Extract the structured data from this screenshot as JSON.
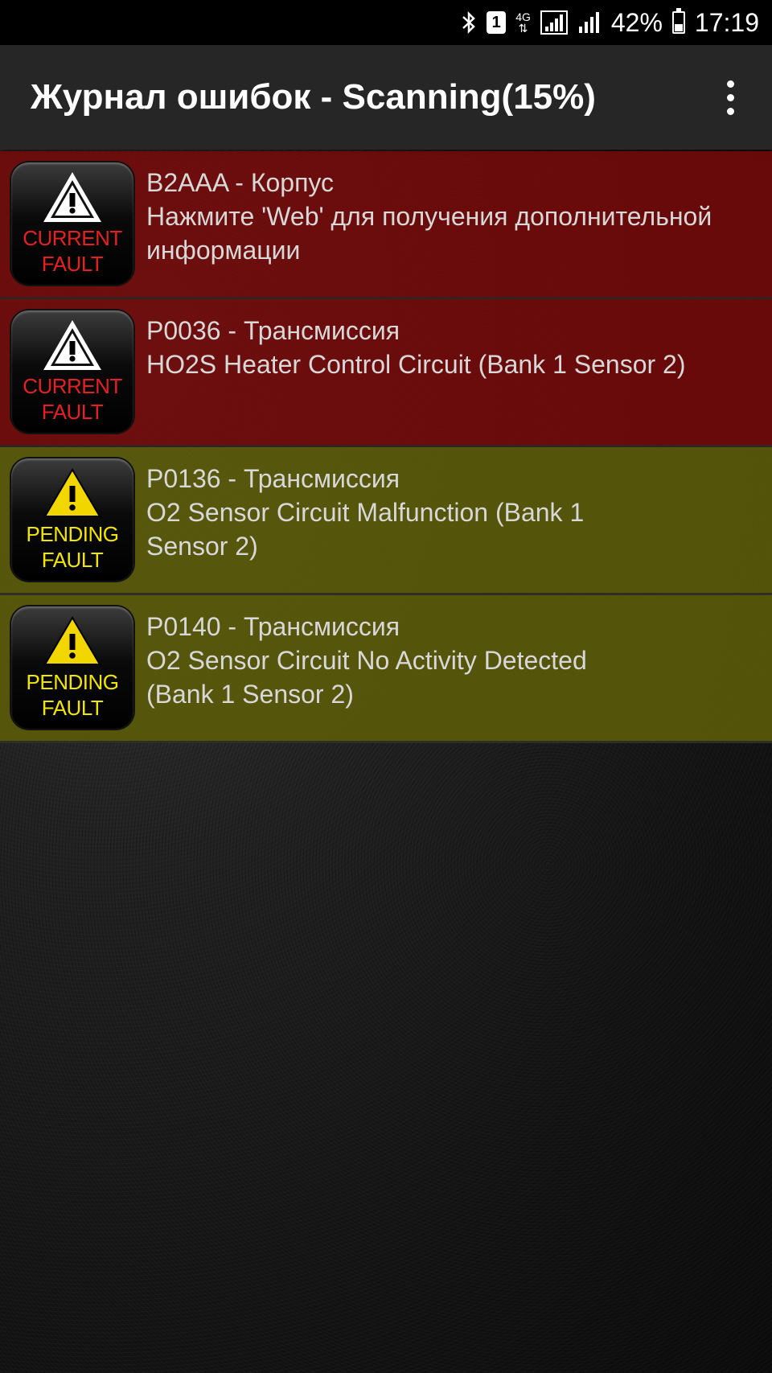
{
  "status_bar": {
    "bluetooth_icon": "bluetooth-icon",
    "sim_label": "1",
    "network_label": "4G",
    "battery_percent": "42%",
    "battery_level": 0.42,
    "time": "17:19"
  },
  "app_bar": {
    "title": "Журнал ошибок - Scanning(15%)",
    "menu_icon": "more-vertical-icon"
  },
  "faults": [
    {
      "kind": "current",
      "badge_line1": "CURRENT",
      "badge_line2": "FAULT",
      "code": "B2AAA - Корпус",
      "description": "Нажмите 'Web' для получения дополнительной информации"
    },
    {
      "kind": "current",
      "badge_line1": "CURRENT",
      "badge_line2": "FAULT",
      "code": "P0036 - Трансмиссия",
      "description": "HO2S Heater Control Circuit (Bank 1 Sensor 2)"
    },
    {
      "kind": "pending",
      "badge_line1": "PENDING",
      "badge_line2": "FAULT",
      "code": "P0136 - Трансмиссия",
      "description": "O2 Sensor Circuit Malfunction (Bank 1 Sensor 2)"
    },
    {
      "kind": "pending",
      "badge_line1": "PENDING",
      "badge_line2": "FAULT",
      "code": "P0140 - Трансмиссия",
      "description": "O2 Sensor Circuit No Activity Detected (Bank 1 Sensor 2)"
    }
  ],
  "colors": {
    "current_row": "#780808",
    "pending_row": "#5c5c08",
    "current_text": "#e62020",
    "pending_text": "#f2e600"
  }
}
